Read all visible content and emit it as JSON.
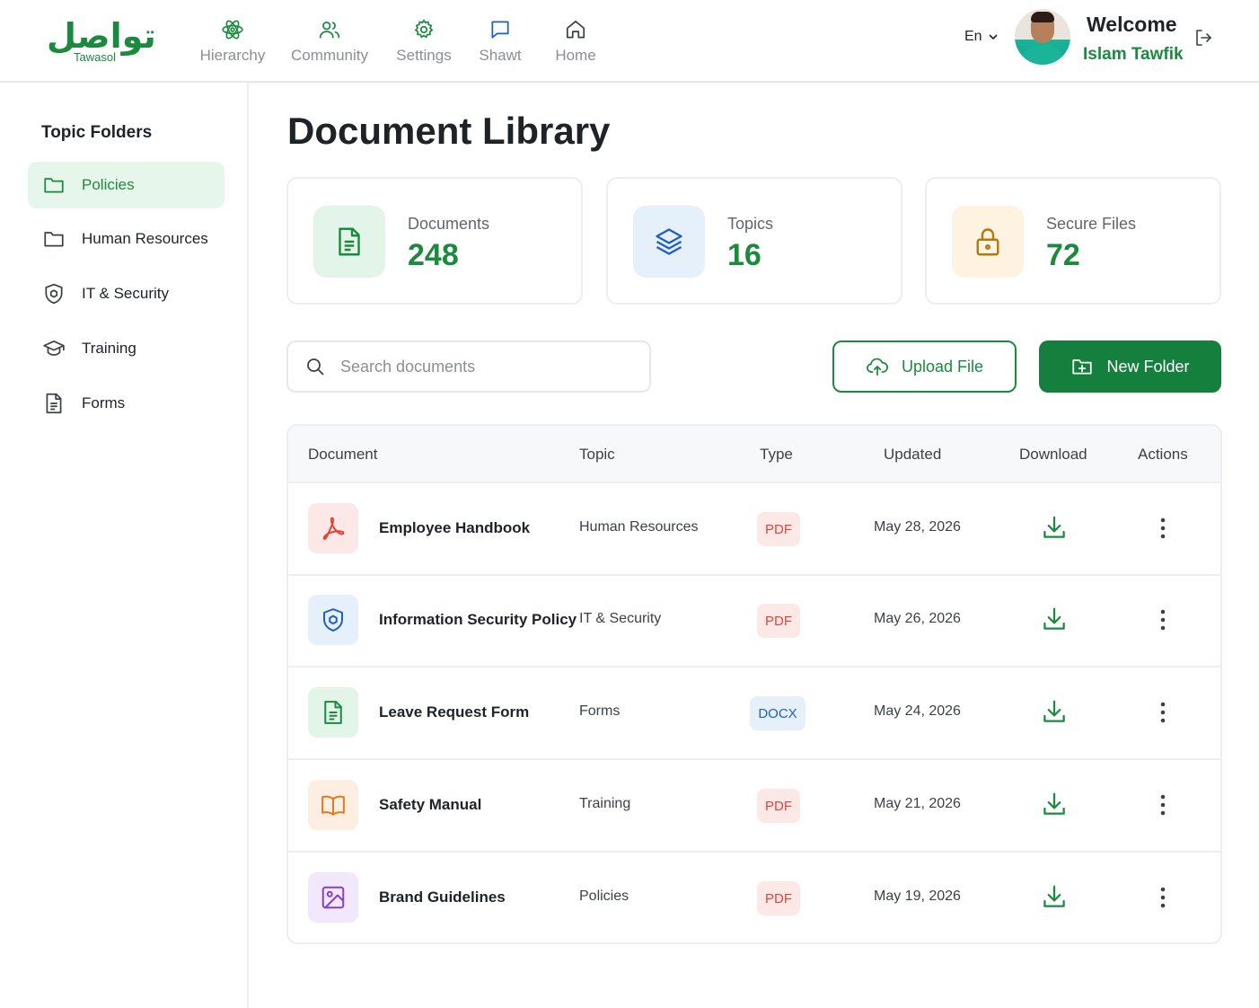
{
  "brand": {
    "logo_arabic": "تواصل",
    "logo_english": "Tawasol",
    "color": "#1b8a3e"
  },
  "nav": [
    {
      "label": "Hierarchy",
      "icon": "atom-icon"
    },
    {
      "label": "Community",
      "icon": "users-icon"
    },
    {
      "label": "Settings",
      "icon": "gear-icon"
    },
    {
      "label": "Shawt",
      "icon": "chat-bubble-icon"
    },
    {
      "label": "Home",
      "icon": "home-icon"
    }
  ],
  "header": {
    "language": "En",
    "welcome": "Welcome",
    "user_name": "Islam Tawfik"
  },
  "sidebar": {
    "title": "Topic Folders",
    "items": [
      {
        "label": "Policies",
        "icon": "folder-icon",
        "active": true
      },
      {
        "label": "Human Resources",
        "icon": "folder-icon",
        "active": false
      },
      {
        "label": "IT & Security",
        "icon": "shield-icon",
        "active": false
      },
      {
        "label": "Training",
        "icon": "graduation-cap-icon",
        "active": false
      },
      {
        "label": "Forms",
        "icon": "document-icon",
        "active": false
      }
    ]
  },
  "main": {
    "title": "Document Library",
    "stats": [
      {
        "label": "Documents",
        "value": "248",
        "icon": "document-icon",
        "bg": "#e3f5e8",
        "color": "#1b8a3e"
      },
      {
        "label": "Topics",
        "value": "16",
        "icon": "layers-icon",
        "bg": "#e6f0fb",
        "color": "#1f5fbf"
      },
      {
        "label": "Secure Files",
        "value": "72",
        "icon": "lock-icon",
        "bg": "#fdf3e0",
        "color": "#b07a12"
      }
    ],
    "search": {
      "placeholder": "Search documents",
      "value": ""
    },
    "upload_label": "Upload File",
    "new_folder_label": "New Folder",
    "table": {
      "columns": [
        "Document",
        "Topic",
        "Type",
        "Updated",
        "Download",
        "Actions"
      ],
      "rows": [
        {
          "name": "Employee Handbook",
          "topic": "Human Resources",
          "type": "PDF",
          "updated": "May 28, 2026",
          "icon": "pdf-icon"
        },
        {
          "name": "Information Security Policy",
          "topic": "IT & Security",
          "type": "PDF",
          "updated": "May 26, 2026",
          "icon": "shield-icon"
        },
        {
          "name": "Leave Request Form",
          "topic": "Forms",
          "type": "DOCX",
          "updated": "May 24, 2026",
          "icon": "document-icon"
        },
        {
          "name": "Safety Manual",
          "topic": "Training",
          "type": "PDF",
          "updated": "May 21, 2026",
          "icon": "book-icon"
        },
        {
          "name": "Brand Guidelines",
          "topic": "Policies",
          "type": "PDF",
          "updated": "May 19, 2026",
          "icon": "image-icon"
        }
      ]
    }
  }
}
